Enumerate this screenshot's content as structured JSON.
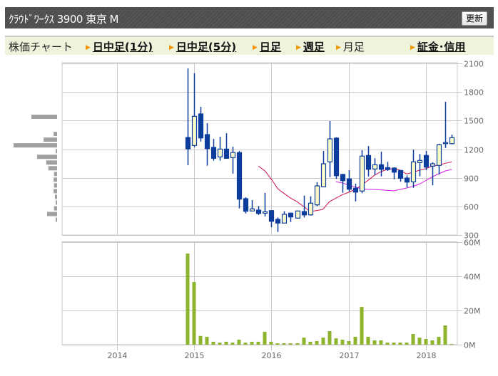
{
  "header": {
    "title": "ｸﾗｳﾄﾞﾜｰｸｽ 3900 東京 M",
    "refresh_label": "更新"
  },
  "nav": {
    "section_label": "株価チャート",
    "items": [
      {
        "label": "日中足(1分)",
        "link": true
      },
      {
        "label": "日中足(5分)",
        "link": true
      },
      {
        "label": "日足",
        "link": true
      },
      {
        "label": "週足",
        "link": true
      },
      {
        "label": "月足",
        "link": false,
        "current": true
      },
      {
        "label": "証金･信用",
        "link": true
      }
    ]
  },
  "colors": {
    "candle": "#0c3c9c",
    "candle_up_fill": "#fcfcc8",
    "ma_short": "#d0104c",
    "ma_long": "#d21ee6",
    "volume": "#8db32f",
    "price_volume": "#a0a0a0",
    "grid": "#c8c8c8"
  },
  "chart_data": [
    {
      "type": "candlestick",
      "period": "monthly",
      "price_axis": {
        "ylim": [
          300,
          2100
        ],
        "ticks": [
          "2100",
          "1800",
          "1500",
          "1200",
          "900",
          "600",
          "300"
        ],
        "position": "right"
      },
      "x_axis": {
        "ticks": [
          "2014",
          "2015",
          "2016",
          "2017",
          "2018"
        ]
      },
      "grid": true,
      "candles": [
        {
          "d": "2014-12",
          "o": 1323,
          "h": 2047,
          "l": 1032,
          "c": 1204
        },
        {
          "d": "2015-01",
          "o": 1239,
          "h": 1997,
          "l": 1221,
          "c": 1545
        },
        {
          "d": "2015-02",
          "o": 1570,
          "h": 1644,
          "l": 1280,
          "c": 1318
        },
        {
          "d": "2015-03",
          "o": 1353,
          "h": 1472,
          "l": 1027,
          "c": 1206
        },
        {
          "d": "2015-04",
          "o": 1219,
          "h": 1308,
          "l": 1079,
          "c": 1104
        },
        {
          "d": "2015-05",
          "o": 1119,
          "h": 1331,
          "l": 1079,
          "c": 1201
        },
        {
          "d": "2015-06",
          "o": 1201,
          "h": 1368,
          "l": 1104,
          "c": 1104
        },
        {
          "d": "2015-07",
          "o": 1112,
          "h": 1226,
          "l": 944,
          "c": 1166
        },
        {
          "d": "2015-08",
          "o": 1164,
          "h": 1181,
          "l": 579,
          "c": 676
        },
        {
          "d": "2015-09",
          "o": 681,
          "h": 696,
          "l": 526,
          "c": 549
        },
        {
          "d": "2015-10",
          "o": 552,
          "h": 666,
          "l": 552,
          "c": 574
        },
        {
          "d": "2015-11",
          "o": 561,
          "h": 604,
          "l": 511,
          "c": 526
        },
        {
          "d": "2015-12",
          "o": 529,
          "h": 741,
          "l": 494,
          "c": 544
        },
        {
          "d": "2016-01",
          "o": 556,
          "h": 556,
          "l": 382,
          "c": 444
        },
        {
          "d": "2016-02",
          "o": 464,
          "h": 484,
          "l": 332,
          "c": 425
        },
        {
          "d": "2016-03",
          "o": 425,
          "h": 549,
          "l": 425,
          "c": 517
        },
        {
          "d": "2016-04",
          "o": 529,
          "h": 534,
          "l": 437,
          "c": 489
        },
        {
          "d": "2016-05",
          "o": 477,
          "h": 556,
          "l": 474,
          "c": 552
        },
        {
          "d": "2016-06",
          "o": 546,
          "h": 713,
          "l": 484,
          "c": 511
        },
        {
          "d": "2016-07",
          "o": 511,
          "h": 706,
          "l": 504,
          "c": 634
        },
        {
          "d": "2016-08",
          "o": 616,
          "h": 855,
          "l": 604,
          "c": 815
        },
        {
          "d": "2016-09",
          "o": 806,
          "h": 1181,
          "l": 806,
          "c": 1047
        },
        {
          "d": "2016-10",
          "o": 1067,
          "h": 1495,
          "l": 907,
          "c": 1308
        },
        {
          "d": "2016-11",
          "o": 1316,
          "h": 1325,
          "l": 888,
          "c": 922
        },
        {
          "d": "2016-12",
          "o": 935,
          "h": 942,
          "l": 743,
          "c": 870
        },
        {
          "d": "2017-01",
          "o": 888,
          "h": 980,
          "l": 756,
          "c": 780
        },
        {
          "d": "2017-02",
          "o": 791,
          "h": 838,
          "l": 653,
          "c": 750
        },
        {
          "d": "2017-03",
          "o": 761,
          "h": 1189,
          "l": 738,
          "c": 1127
        },
        {
          "d": "2017-04",
          "o": 1134,
          "h": 1233,
          "l": 915,
          "c": 989
        },
        {
          "d": "2017-05",
          "o": 992,
          "h": 1106,
          "l": 927,
          "c": 1037
        },
        {
          "d": "2017-06",
          "o": 1037,
          "h": 1174,
          "l": 915,
          "c": 989
        },
        {
          "d": "2017-07",
          "o": 1007,
          "h": 1067,
          "l": 972,
          "c": 987
        },
        {
          "d": "2017-08",
          "o": 1002,
          "h": 1010,
          "l": 885,
          "c": 959
        },
        {
          "d": "2017-09",
          "o": 977,
          "h": 980,
          "l": 860,
          "c": 895
        },
        {
          "d": "2017-10",
          "o": 897,
          "h": 925,
          "l": 798,
          "c": 855
        },
        {
          "d": "2017-11",
          "o": 858,
          "h": 1196,
          "l": 795,
          "c": 1067
        },
        {
          "d": "2017-12",
          "o": 1059,
          "h": 1149,
          "l": 915,
          "c": 1082
        },
        {
          "d": "2018-01",
          "o": 1134,
          "h": 1181,
          "l": 980,
          "c": 1012
        },
        {
          "d": "2018-02",
          "o": 1022,
          "h": 1062,
          "l": 821,
          "c": 1047
        },
        {
          "d": "2018-03",
          "o": 1030,
          "h": 1258,
          "l": 937,
          "c": 1248
        },
        {
          "d": "2018-04",
          "o": 1265,
          "h": 1697,
          "l": 1213,
          "c": 1269
        },
        {
          "d": "2018-05",
          "o": 1258,
          "h": 1353,
          "l": 1251,
          "c": 1321
        }
      ],
      "moving_averages": [
        {
          "color_key": "ma_short",
          "start": "2015-11",
          "values": [
            1022,
            972,
            885,
            785,
            735,
            686,
            649,
            599,
            549,
            556,
            570,
            649,
            686,
            723,
            748,
            778,
            823,
            873,
            927,
            964,
            989,
            997,
            980,
            940,
            959,
            980,
            997,
            1022,
            1034,
            1052,
            1067
          ]
        },
        {
          "color_key": "ma_long",
          "start": "2016-11",
          "values": [
            858,
            847,
            823,
            803,
            785,
            778,
            778,
            773,
            768,
            763,
            778,
            793,
            810,
            835,
            873,
            910,
            942,
            972,
            987
          ]
        }
      ],
      "price_volume_profile": {
        "bin_prices": [
          1540,
          1480,
          1420,
          1360,
          1300,
          1240,
          1180,
          1120,
          1060,
          1000,
          940,
          880,
          820,
          760,
          700,
          640,
          580,
          520,
          460
        ],
        "relative_volume": [
          59,
          0,
          0,
          8,
          31,
          100,
          3,
          46,
          25,
          20,
          7,
          8,
          7,
          8,
          5,
          3,
          7,
          23,
          3
        ]
      }
    },
    {
      "type": "bar",
      "title": "",
      "y_axis": {
        "ylim": [
          0,
          60
        ],
        "unit": "M",
        "ticks": [
          "60M",
          "40M",
          "20M",
          "0M"
        ],
        "position": "right"
      },
      "volume_millions": [
        53.1,
        36.5,
        5.1,
        4.6,
        1.7,
        1.2,
        1.7,
        1.2,
        2.9,
        1.2,
        1.7,
        1.7,
        7.5,
        1.7,
        0.8,
        0.8,
        0.8,
        0.8,
        4.1,
        1.7,
        2.1,
        4.1,
        7.9,
        3.7,
        2.9,
        2.1,
        4.6,
        22.0,
        4.6,
        2.5,
        2.5,
        1.2,
        1.2,
        1.2,
        1.2,
        6.2,
        4.1,
        3.3,
        2.5,
        4.6,
        11.2,
        0.4
      ]
    }
  ]
}
